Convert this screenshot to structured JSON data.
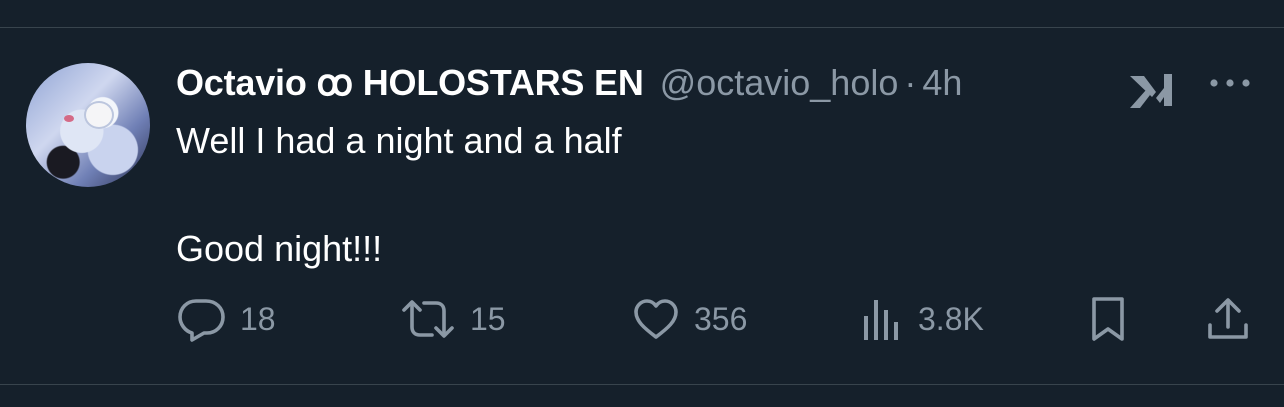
{
  "tweet": {
    "display_name": "Octavio ꝏ HOLOSTARS EN",
    "handle": "@octavio_holo",
    "separator": "·",
    "time": "4h",
    "text": "Well I had a night and a half\n\nGood night!!!"
  },
  "actions": {
    "replies": "18",
    "retweets": "15",
    "likes": "356",
    "views": "3.8K"
  },
  "icons": {
    "avatar": "avatar",
    "grok": "grok-icon",
    "more": "more-icon",
    "reply": "reply-icon",
    "retweet": "retweet-icon",
    "like": "heart-icon",
    "views": "views-icon",
    "bookmark": "bookmark-icon",
    "share": "share-icon"
  },
  "colors": {
    "background": "#15202b",
    "secondary_text": "#8b98a5",
    "divider": "#38444d"
  }
}
